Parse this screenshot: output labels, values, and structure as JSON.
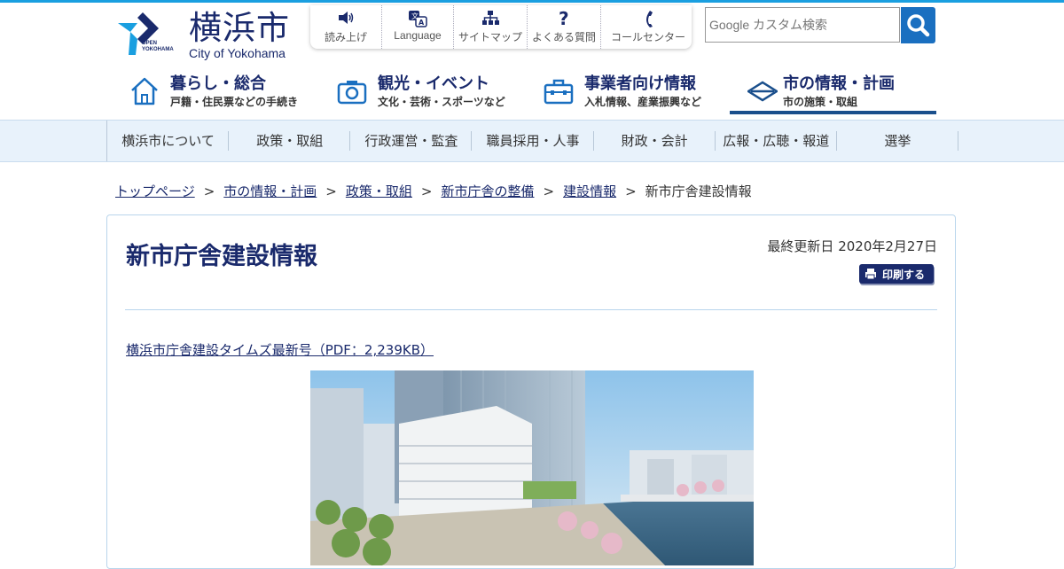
{
  "logo": {
    "kanji": "横浜市",
    "english": "City of Yokohama",
    "mark_text_1": "OPEN",
    "mark_text_2": "YOKOHAMA"
  },
  "utility": [
    {
      "label": "読み上げ",
      "icon": "speaker-icon"
    },
    {
      "label": "Language",
      "icon": "translate-icon"
    },
    {
      "label": "サイトマップ",
      "icon": "sitemap-icon"
    },
    {
      "label": "よくある質問",
      "icon": "question-icon"
    },
    {
      "label": "コールセンター",
      "icon": "phone-icon"
    }
  ],
  "search": {
    "placeholder": "Google カスタム検索",
    "button_icon": "search-icon"
  },
  "main_nav": [
    {
      "title": "暮らし・総合",
      "sub": "戸籍・住民票などの手続き",
      "icon": "house-icon"
    },
    {
      "title": "観光・イベント",
      "sub": "文化・芸術・スポーツなど",
      "icon": "camera-icon"
    },
    {
      "title": "事業者向け情報",
      "sub": "入札情報、産業振興など",
      "icon": "toolbox-icon"
    },
    {
      "title": "市の情報・計画",
      "sub": "市の施策・取組",
      "icon": "city-emblem-icon",
      "active": true
    }
  ],
  "sub_nav": [
    "横浜市について",
    "政策・取組",
    "行政運営・監査",
    "職員採用・人事",
    "財政・会計",
    "広報・広聴・報道",
    "選挙"
  ],
  "breadcrumb": [
    "トップページ",
    "市の情報・計画",
    "政策・取組",
    "新市庁舎の整備",
    "建設情報",
    "新市庁舎建設情報"
  ],
  "page": {
    "title": "新市庁舎建設情報",
    "updated": "最終更新日 2020年2月27日",
    "print_label": "印刷する",
    "pdf_link": "横浜市庁舎建設タイムズ最新号（PDF：2,239KB）"
  },
  "colors": {
    "accent": "#1a9fe0",
    "brand": "#1a2a6c",
    "search_button": "#1a6fc0",
    "subnav_bg": "#e8f2fb"
  }
}
